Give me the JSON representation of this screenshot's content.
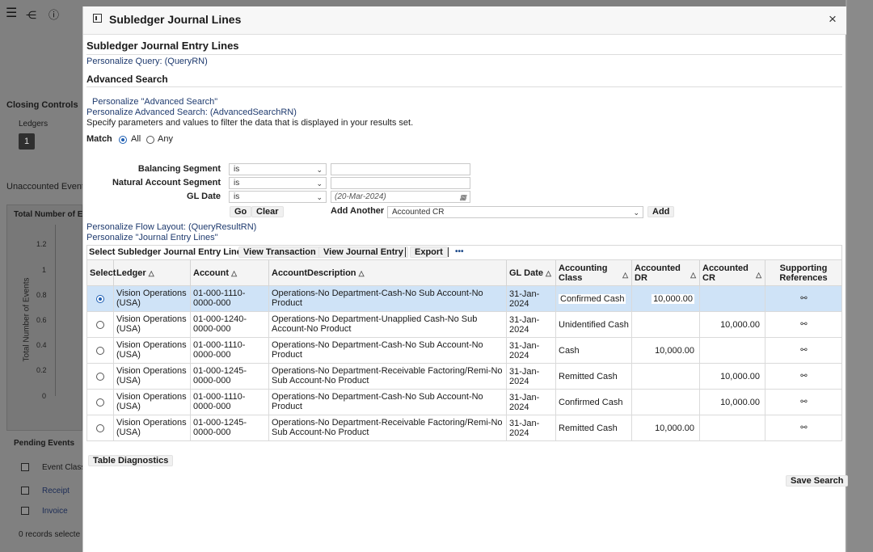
{
  "background": {
    "closing_controls": "Closing Controls",
    "ledgers": "Ledgers",
    "ledger_count": "1",
    "unaccounted_events": "Unaccounted Events",
    "total_number_short": "Total Number of E",
    "y_axis_label": "Total Number of Events",
    "y_ticks": [
      "1.2",
      "1",
      "0.8",
      "0.6",
      "0.4",
      "0.2",
      "0"
    ],
    "pending_events": "Pending Events",
    "event_class_header": "Event Class",
    "pending_rows": [
      "Receipt",
      "Invoice"
    ],
    "records_selected": "0 records selecte"
  },
  "dialog": {
    "title": "Subledger Journal Lines",
    "close_glyph": "×"
  },
  "query": {
    "heading": "Subledger Journal Entry Lines",
    "personalize_query": "Personalize Query: (QueryRN)",
    "advanced_search": "Advanced Search",
    "personalize_adv": "Personalize \"Advanced Search\"",
    "personalize_adv_rn": "Personalize Advanced Search: (AdvancedSearchRN)",
    "instructions": "Specify parameters and values to filter the data that is displayed in your results set.",
    "match_label": "Match",
    "match_all": "All",
    "match_any": "Any",
    "fields": [
      {
        "label": "Balancing Segment",
        "operator": "is",
        "value": ""
      },
      {
        "label": "Natural Account Segment",
        "operator": "is",
        "value": ""
      },
      {
        "label": "GL Date",
        "operator": "is",
        "value": "(20-Mar-2024)"
      }
    ],
    "go": "Go",
    "clear": "Clear",
    "add_another_label": "Add Another",
    "add_another_value": "Accounted CR",
    "add": "Add",
    "personalize_flow": "Personalize Flow Layout: (QueryResultRN)",
    "personalize_jel": "Personalize \"Journal Entry Lines\""
  },
  "toolbar": {
    "select_label": "Select Subledger Journal Entry Line:",
    "view_transaction": "View Transaction",
    "view_journal_entry": "View Journal Entry",
    "export": "Export",
    "more": "•••"
  },
  "table": {
    "headers": [
      "Select",
      "Ledger",
      "Account",
      "AccountDescription",
      "GL Date",
      "Accounting Class",
      "Accounted DR",
      "Accounted CR",
      "Supporting References"
    ],
    "rows": [
      {
        "selected": true,
        "ledger": "Vision Operations (USA)",
        "account": "01-000-1110-0000-000",
        "desc": "Operations-No Department-Cash-No Sub Account-No Product",
        "gl_date": "31-Jan-2024",
        "class": "Confirmed Cash",
        "dr": "10,000.00",
        "cr": ""
      },
      {
        "selected": false,
        "ledger": "Vision Operations (USA)",
        "account": "01-000-1240-0000-000",
        "desc": "Operations-No Department-Unapplied Cash-No Sub Account-No Product",
        "gl_date": "31-Jan-2024",
        "class": "Unidentified Cash",
        "dr": "",
        "cr": "10,000.00"
      },
      {
        "selected": false,
        "ledger": "Vision Operations (USA)",
        "account": "01-000-1110-0000-000",
        "desc": "Operations-No Department-Cash-No Sub Account-No Product",
        "gl_date": "31-Jan-2024",
        "class": "Cash",
        "dr": "10,000.00",
        "cr": ""
      },
      {
        "selected": false,
        "ledger": "Vision Operations (USA)",
        "account": "01-000-1245-0000-000",
        "desc": "Operations-No Department-Receivable Factoring/Remi-No Sub Account-No Product",
        "gl_date": "31-Jan-2024",
        "class": "Remitted Cash",
        "dr": "",
        "cr": "10,000.00"
      },
      {
        "selected": false,
        "ledger": "Vision Operations (USA)",
        "account": "01-000-1110-0000-000",
        "desc": "Operations-No Department-Cash-No Sub Account-No Product",
        "gl_date": "31-Jan-2024",
        "class": "Confirmed Cash",
        "dr": "",
        "cr": "10,000.00"
      },
      {
        "selected": false,
        "ledger": "Vision Operations (USA)",
        "account": "01-000-1245-0000-000",
        "desc": "Operations-No Department-Receivable Factoring/Remi-No Sub Account-No Product",
        "gl_date": "31-Jan-2024",
        "class": "Remitted Cash",
        "dr": "10,000.00",
        "cr": ""
      }
    ]
  },
  "footer": {
    "table_diagnostics": "Table Diagnostics",
    "save_search": "Save Search"
  },
  "colors": {
    "selected_row": "#cfe3f7",
    "link": "#1e3a6e",
    "overlay": "#808080"
  }
}
